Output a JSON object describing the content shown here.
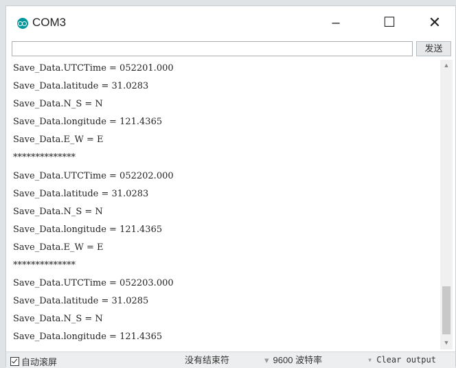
{
  "window": {
    "title": "COM3",
    "minimize": "–",
    "maximize": "☐",
    "close": "✕"
  },
  "send": {
    "input_value": "",
    "button_label": "发送"
  },
  "output": {
    "lines": [
      "Save_Data.UTCTime = 052201.000",
      "Save_Data.latitude = 31.0283",
      "Save_Data.N_S = N",
      "Save_Data.longitude = 121.4365",
      "Save_Data.E_W = E",
      "**************",
      "Save_Data.UTCTime = 052202.000",
      "Save_Data.latitude = 31.0283",
      "Save_Data.N_S = N",
      "Save_Data.longitude = 121.4365",
      "Save_Data.E_W = E",
      "**************",
      "Save_Data.UTCTime = 052203.000",
      "Save_Data.latitude = 31.0285",
      "Save_Data.N_S = N",
      "Save_Data.longitude = 121.4365"
    ]
  },
  "statusbar": {
    "autoscroll_label": "自动滚屏",
    "autoscroll_checked": true,
    "line_ending": "没有结束符",
    "baud_rate": "9600 波特率",
    "clear_output": "Clear output"
  },
  "icons": {
    "app": "arduino-icon",
    "scroll_up": "▲",
    "scroll_down": "▼",
    "dropdown": "▾"
  }
}
